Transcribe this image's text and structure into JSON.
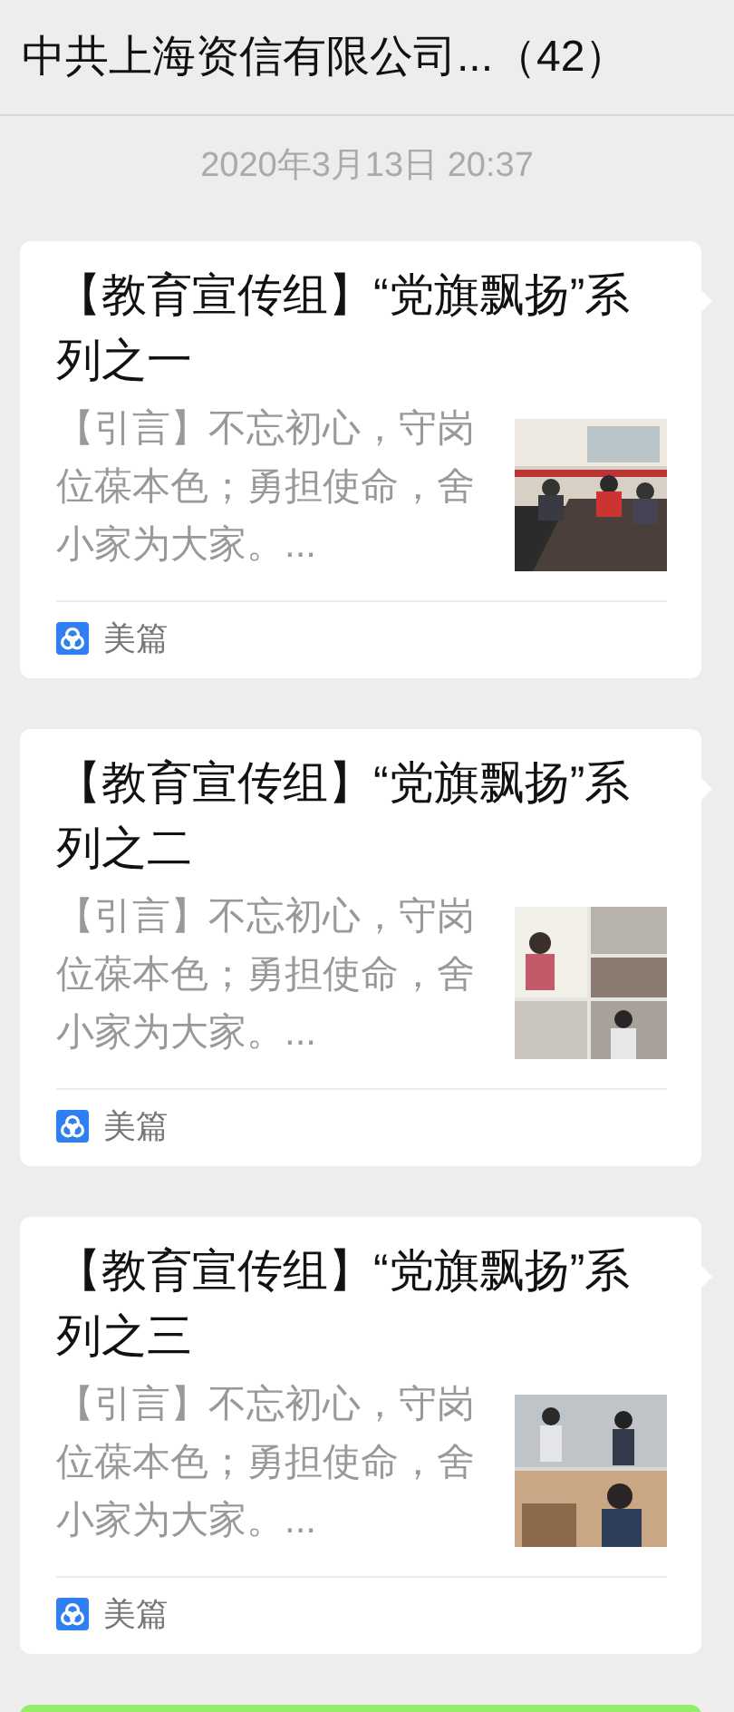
{
  "header": {
    "title": "中共上海资信有限公司...（42）"
  },
  "timestamp": "2020年3月13日 20:37",
  "messages": [
    {
      "kind": "link_card",
      "title": "【教育宣传组】“党旗飘扬”系列之一",
      "description": "【引言】不忘初心，守岗位葆本色；勇担使命，舍小家为大家。...",
      "source": "美篇"
    },
    {
      "kind": "link_card",
      "title": "【教育宣传组】“党旗飘扬”系列之二",
      "description": "【引言】不忘初心，守岗位葆本色；勇担使命，舍小家为大家。...",
      "source": "美篇"
    },
    {
      "kind": "link_card",
      "title": "【教育宣传组】“党旗飘扬”系列之三",
      "description": "【引言】不忘初心，守岗位葆本色；勇担使命，舍小家为大家。...",
      "source": "美篇"
    }
  ]
}
